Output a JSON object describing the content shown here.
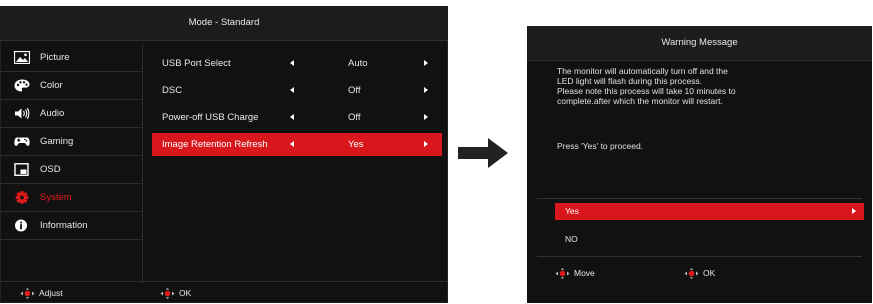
{
  "osd": {
    "title": "Mode - Standard",
    "sidebar": [
      {
        "label": "Picture",
        "icon": "picture-icon",
        "active": false
      },
      {
        "label": "Color",
        "icon": "palette-icon",
        "active": false
      },
      {
        "label": "Audio",
        "icon": "speaker-icon",
        "active": false
      },
      {
        "label": "Gaming",
        "icon": "gamepad-icon",
        "active": false
      },
      {
        "label": "OSD",
        "icon": "osd-window-icon",
        "active": false
      },
      {
        "label": "System",
        "icon": "gear-icon",
        "active": true
      },
      {
        "label": "Information",
        "icon": "info-icon",
        "active": false
      }
    ],
    "settings": [
      {
        "label": "USB Port Select",
        "value": "Auto",
        "selected": false
      },
      {
        "label": "DSC",
        "value": "Off",
        "selected": false
      },
      {
        "label": "Power-off USB Charge",
        "value": "Off",
        "selected": false
      },
      {
        "label": "Image Retention Refresh",
        "value": "Yes",
        "selected": true
      }
    ],
    "footer": {
      "adjust_label": "Adjust",
      "ok_label": "OK"
    }
  },
  "warning": {
    "title": "Warning Message",
    "lines": [
      "The monitor will automatically turn off and the",
      "LED light will flash during this process.",
      "Please note this process will take 10 minutes to",
      "complete.after which the monitor will restart."
    ],
    "prompt": "Press 'Yes' to proceed.",
    "options": [
      {
        "label": "Yes",
        "selected": true
      },
      {
        "label": "NO",
        "selected": false
      }
    ],
    "footer": {
      "move_label": "Move",
      "ok_label": "OK"
    }
  },
  "colors": {
    "accent": "#d9161c",
    "background": "#111111",
    "text": "#e8e8e8"
  }
}
